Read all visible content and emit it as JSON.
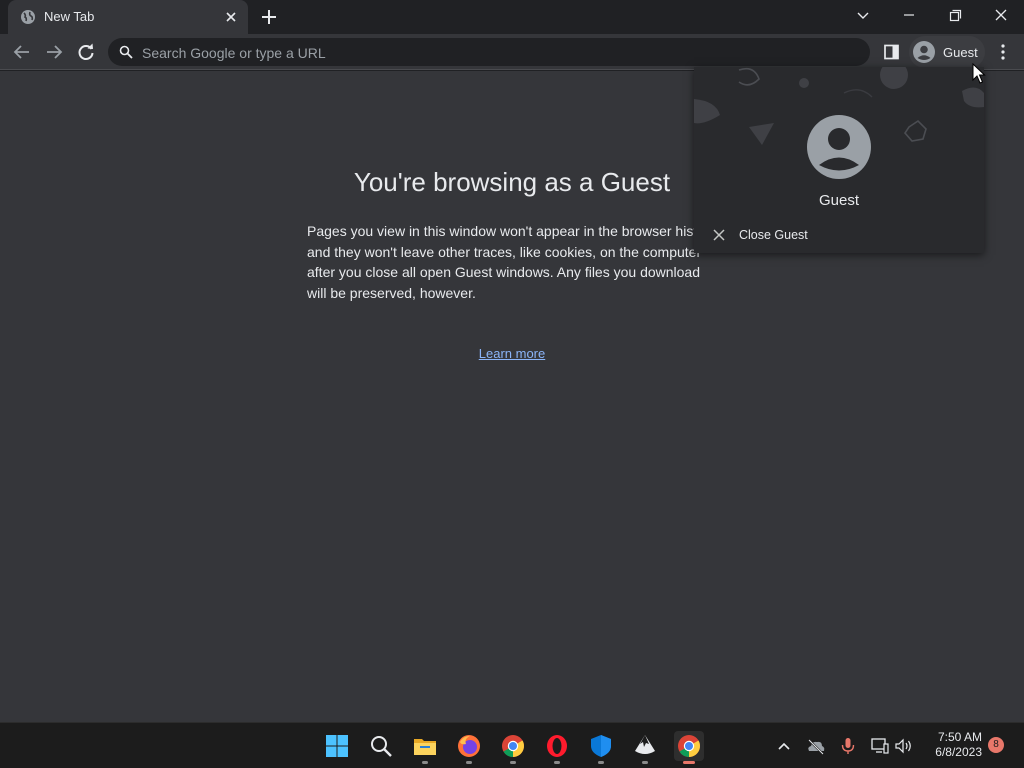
{
  "tab": {
    "title": "New Tab"
  },
  "omnibox": {
    "placeholder": "Search Google or type a URL"
  },
  "profile_button": {
    "name": "Guest"
  },
  "page": {
    "headline": "You're browsing as a Guest",
    "description": "Pages you view in this window won't appear in the browser history and they won't leave other traces, like cookies, on the computer after you close all open Guest windows. Any files you download will be preserved, however.",
    "learn_more": "Learn more"
  },
  "profile_popup": {
    "name": "Guest",
    "close_label": "Close Guest"
  },
  "taskbar": {
    "apps": [
      "start-icon",
      "search-icon",
      "file-explorer-icon",
      "firefox-icon",
      "chrome-icon",
      "opera-icon",
      "defender-icon",
      "inkscape-icon",
      "chrome-icon"
    ],
    "clock_time": "7:50 AM",
    "clock_date": "6/8/2023",
    "notification_count": "8"
  },
  "colors": {
    "frame": "#202124",
    "toolbar": "#35363a",
    "link": "#8ab4f8",
    "accent": "#e8776a"
  }
}
